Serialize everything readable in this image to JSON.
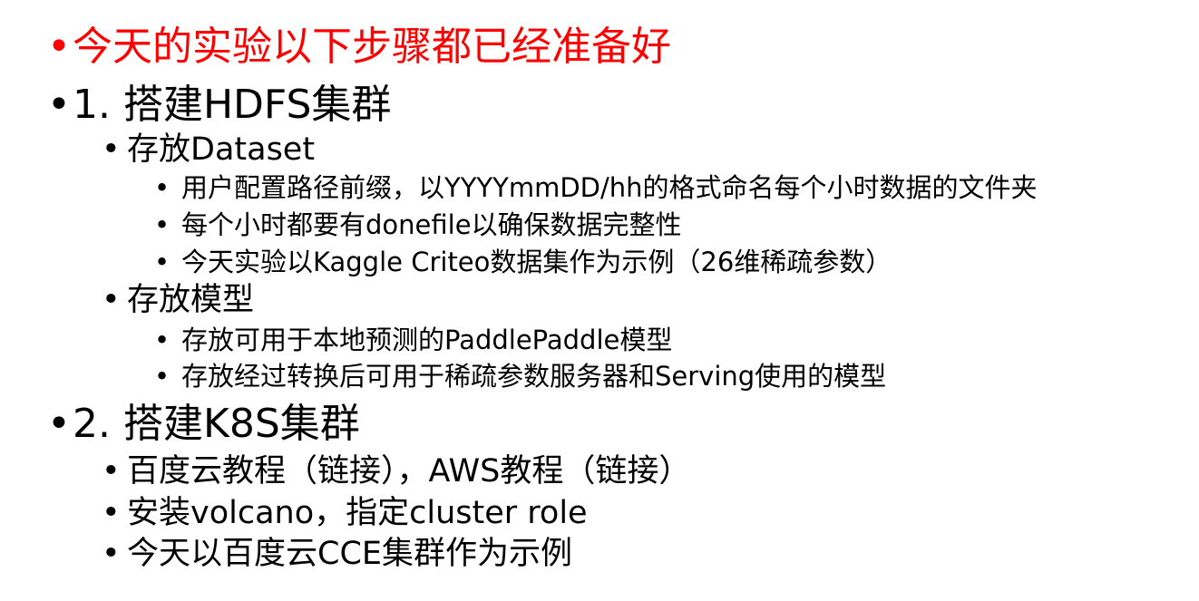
{
  "bullet_char": "•",
  "accent_color": "#ff0000",
  "items": [
    {
      "level": 1,
      "text": "今天的实验以下步骤都已经准备好",
      "color": "#ff0000"
    },
    {
      "level": 1,
      "text": "1. 搭建HDFS集群"
    },
    {
      "level": 2,
      "text": "存放Dataset"
    },
    {
      "level": 3,
      "text": "用户配置路径前缀，以YYYYmmDD/hh的格式命名每个小时数据的文件夹"
    },
    {
      "level": 3,
      "text": "每个小时都要有donefile以确保数据完整性"
    },
    {
      "level": 3,
      "text": "今天实验以Kaggle Criteo数据集作为示例（26维稀疏参数）"
    },
    {
      "level": 2,
      "text": "存放模型"
    },
    {
      "level": 3,
      "text": "存放可用于本地预测的PaddlePaddle模型"
    },
    {
      "level": 3,
      "text": "存放经过转换后可用于稀疏参数服务器和Serving使用的模型"
    },
    {
      "level": 1,
      "text": "2. 搭建K8S集群"
    },
    {
      "level": 2,
      "text": "百度云教程（链接），AWS教程（链接）"
    },
    {
      "level": 2,
      "text": "安装volcano，指定cluster role"
    },
    {
      "level": 2,
      "text": "今天以百度云CCE集群作为示例"
    }
  ]
}
